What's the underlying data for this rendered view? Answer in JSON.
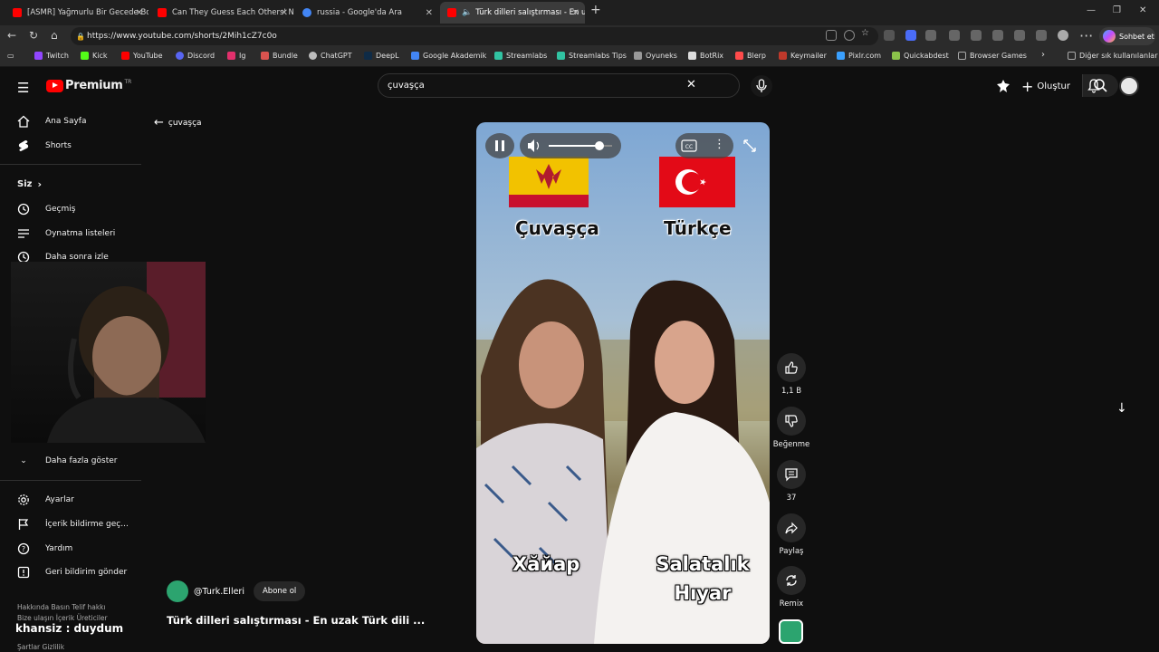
{
  "browser": {
    "tabs": [
      {
        "title": "[ASMR] Yağmurlu Bir Gecede Boş",
        "favicon_color": "#ff0000"
      },
      {
        "title": "Can They Guess Each Others' Nati",
        "favicon_color": "#ff0000"
      },
      {
        "title": "russia - Google'da Ara",
        "favicon_color": "#4285f4"
      },
      {
        "title": "Türk dilleri salıştırması - En uza",
        "favicon_color": "#ff0000"
      }
    ],
    "url": "https://www.youtube.com/shorts/2Mih1cZ7c0o",
    "copilot_label": "Sohbet et",
    "bookmarks": [
      {
        "label": "Twitch",
        "color": "#9146ff"
      },
      {
        "label": "Kick",
        "color": "#53fc18"
      },
      {
        "label": "YouTube",
        "color": "#ff0000"
      },
      {
        "label": "Discord",
        "color": "#5865f2"
      },
      {
        "label": "Ig",
        "color": "#e1306c"
      },
      {
        "label": "Bundle",
        "color": "#d9534f"
      },
      {
        "label": "ChatGPT",
        "color": "#bbbbbb"
      },
      {
        "label": "DeepL",
        "color": "#0f2b46"
      },
      {
        "label": "Google Akademik",
        "color": "#4285f4"
      },
      {
        "label": "Streamlabs",
        "color": "#31c3a2"
      },
      {
        "label": "Streamlabs Tips",
        "color": "#31c3a2"
      },
      {
        "label": "Oyuneks",
        "color": "#999999"
      },
      {
        "label": "BotRix",
        "color": "#dddddd"
      },
      {
        "label": "Blerp",
        "color": "#ff4b4b"
      },
      {
        "label": "Keymailer",
        "color": "#c0392b"
      },
      {
        "label": "Pixlr.com",
        "color": "#3aa0ff"
      },
      {
        "label": "Quickabdest",
        "color": "#8bc34a"
      },
      {
        "label": "Browser Games",
        "color": "#888888"
      }
    ],
    "other_bookmarks": "Diğer sık kullanılanlar"
  },
  "youtube": {
    "logo_text": "Premium",
    "logo_region": "TR",
    "search_value": "çuvaşça",
    "create_label": "Oluştur",
    "sidebar": {
      "items": [
        {
          "label": "Ana Sayfa",
          "icon": "home-icon"
        },
        {
          "label": "Shorts",
          "icon": "shorts-icon"
        }
      ],
      "you_header": "Siz",
      "you_items": [
        {
          "label": "Geçmiş",
          "icon": "history-icon"
        },
        {
          "label": "Oynatma listeleri",
          "icon": "playlist-icon"
        },
        {
          "label": "Daha sonra izle",
          "icon": "clock-icon"
        }
      ],
      "show_more": "Daha fazla göster",
      "bottom_items": [
        {
          "label": "Ayarlar",
          "icon": "gear-icon"
        },
        {
          "label": "İçerik bildirme geç...",
          "icon": "flag-icon"
        },
        {
          "label": "Yardım",
          "icon": "help-icon"
        },
        {
          "label": "Geri bildirim gönder",
          "icon": "feedback-icon"
        }
      ],
      "footer1": "Hakkında  Basın  Telif hakkı",
      "footer2": "Bize ulaşın  İçerik Üreticiler",
      "footer3": "Şartlar  Gizlilik"
    },
    "back_label": "çuvaşça",
    "video": {
      "lang_left": "Çuvaşça",
      "lang_right": "Türkçe",
      "word_left": "Хăйар",
      "word_right_line1": "Salatalık",
      "word_right_line2": "Hıyar",
      "volume_level": 0.8
    },
    "actions": {
      "like_count": "1,1 B",
      "dislike_label": "Beğenme",
      "comment_count": "37",
      "share_label": "Paylaş",
      "remix_label": "Remix"
    },
    "channel_name": "@Turk.Elleri",
    "subscribe_label": "Abone ol",
    "video_title": "Türk dilleri salıştırması - En uzak Türk dili ..."
  },
  "overlay_watermark": "khansiz : duydum",
  "colors": {
    "accent_red": "#ff0000",
    "bg": "#0f0f0f",
    "flag_chuvash_yellow": "#f2c200",
    "flag_chuvash_red": "#c8102e",
    "flag_turkey_red": "#e30a17"
  }
}
